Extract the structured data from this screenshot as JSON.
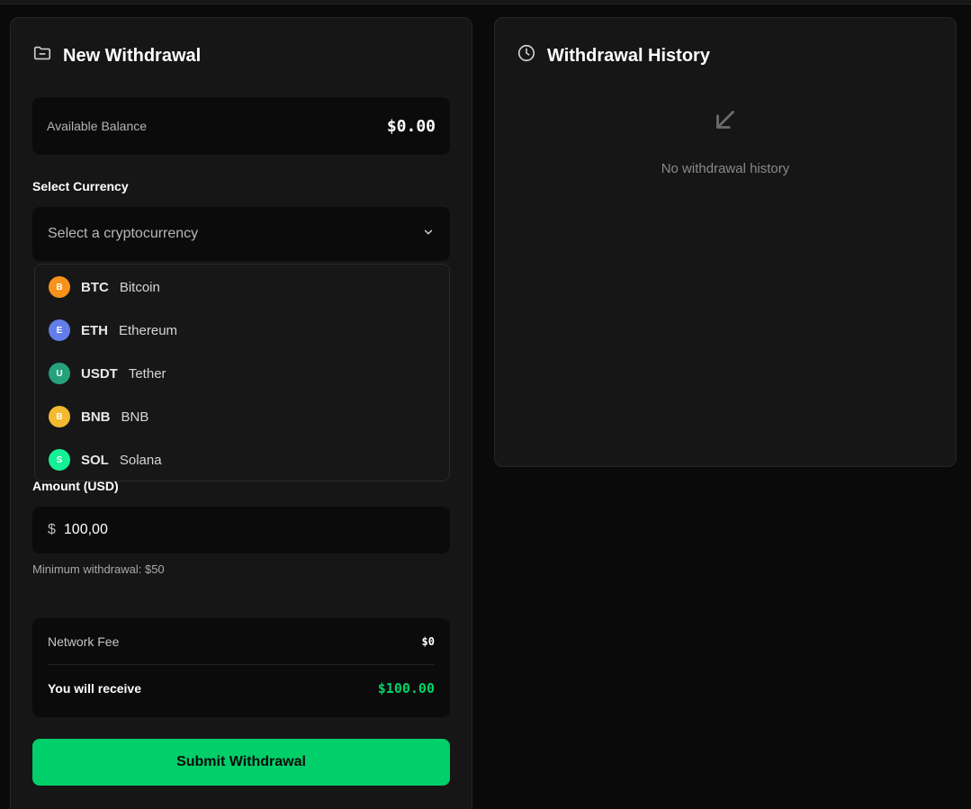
{
  "withdraw": {
    "title": "New Withdrawal",
    "balance_label": "Available Balance",
    "balance_value": "$0.00",
    "currency_label": "Select Currency",
    "currency_placeholder": "Select a cryptocurrency",
    "currency_options": [
      {
        "letter": "B",
        "symbol": "BTC",
        "name": "Bitcoin",
        "color": "#f7931a"
      },
      {
        "letter": "E",
        "symbol": "ETH",
        "name": "Ethereum",
        "color": "#627eea"
      },
      {
        "letter": "U",
        "symbol": "USDT",
        "name": "Tether",
        "color": "#26a17b"
      },
      {
        "letter": "B",
        "symbol": "BNB",
        "name": "BNB",
        "color": "#f3ba2f"
      },
      {
        "letter": "S",
        "symbol": "SOL",
        "name": "Solana",
        "color": "#14f195"
      }
    ],
    "amount_label": "Amount (USD)",
    "amount_prefix": "$",
    "amount_value": "100,00",
    "min_hint": "Minimum withdrawal: $50",
    "fee_label": "Network Fee",
    "fee_value": "$0",
    "receive_label": "You will receive",
    "receive_value": "$100.00",
    "submit_label": "Submit Withdrawal"
  },
  "history": {
    "title": "Withdrawal History",
    "empty_text": "No withdrawal history"
  },
  "colors": {
    "accent": "#00cf6a",
    "receive": "#00d16a",
    "background": "#0a0a0a",
    "card": "#161616"
  },
  "icons": {
    "withdraw_title": "folder-minus-icon",
    "history_title": "clock-icon",
    "select_chevron": "chevron-down-icon",
    "empty_state": "arrow-down-left-icon"
  }
}
